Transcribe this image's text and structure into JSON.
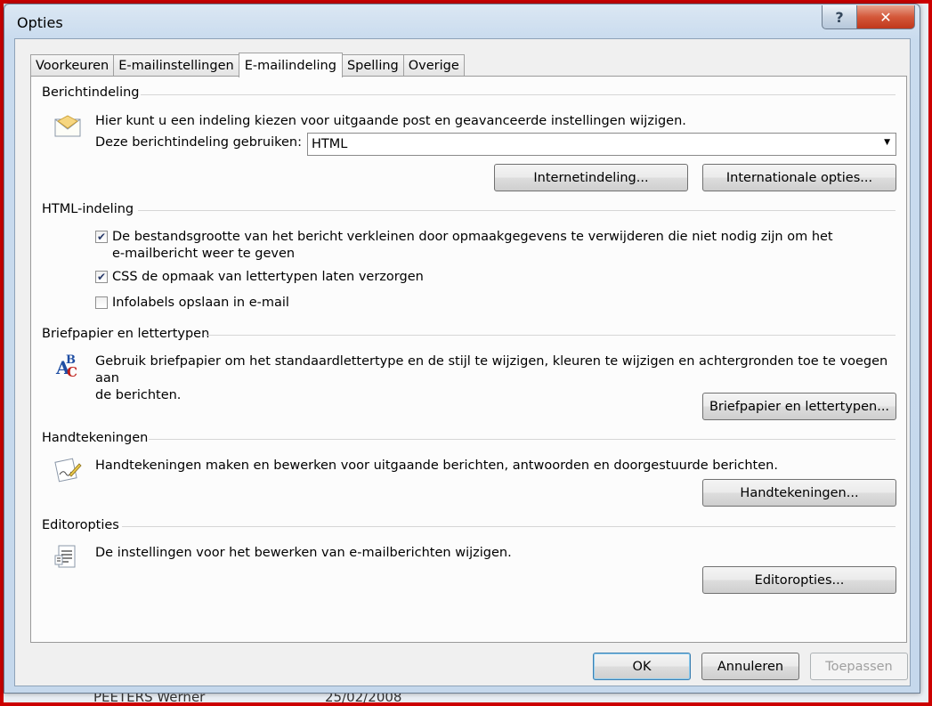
{
  "window": {
    "title": "Opties"
  },
  "titlebar": {
    "help_glyph": "?",
    "close_glyph": "✕"
  },
  "background": {
    "row_name": "PEETERS Werner",
    "row_date": "25/02/2008"
  },
  "tabs": [
    {
      "label": "Voorkeuren"
    },
    {
      "label": "E-mailinstellingen"
    },
    {
      "label": "E-mailindeling",
      "active": true
    },
    {
      "label": "Spelling"
    },
    {
      "label": "Overige"
    }
  ],
  "sections": {
    "berichtindeling": {
      "heading": "Berichtindeling",
      "icon": "envelope-icon",
      "description": "Hier kunt u een indeling kiezen voor uitgaande post en geavanceerde instellingen wijzigen.",
      "format_label": "Deze berichtindeling gebruiken:",
      "format_value": "HTML",
      "internet_button": "Internetindeling...",
      "international_button": "Internationale opties..."
    },
    "html": {
      "heading": "HTML-indeling",
      "options": [
        {
          "line1": "De bestandsgrootte van het bericht verkleinen door opmaakgegevens te verwijderen die niet nodig zijn om het",
          "line2": "e-mailbericht weer te geven",
          "checked": true
        },
        {
          "line1": "CSS de opmaak van lettertypen laten verzorgen",
          "checked": true
        },
        {
          "line1": "Infolabels opslaan in e-mail",
          "checked": false
        }
      ]
    },
    "briefpapier": {
      "heading": "Briefpapier en lettertypen",
      "icon": "abc-font-icon",
      "description_line1": "Gebruik briefpapier om het standaardlettertype en de stijl te wijzigen, kleuren te wijzigen en achtergronden toe te voegen aan",
      "description_line2": "de berichten.",
      "button": "Briefpapier en lettertypen..."
    },
    "handtekeningen": {
      "heading": "Handtekeningen",
      "icon": "signature-pen-icon",
      "description": "Handtekeningen maken en bewerken voor uitgaande berichten, antwoorden en doorgestuurde berichten.",
      "button": "Handtekeningen..."
    },
    "editor": {
      "heading": "Editoropties",
      "icon": "document-icon",
      "description": "De instellingen voor het bewerken van e-mailberichten wijzigen.",
      "button": "Editoropties..."
    }
  },
  "footer": {
    "ok": "OK",
    "cancel": "Annuleren",
    "apply": "Toepassen"
  }
}
